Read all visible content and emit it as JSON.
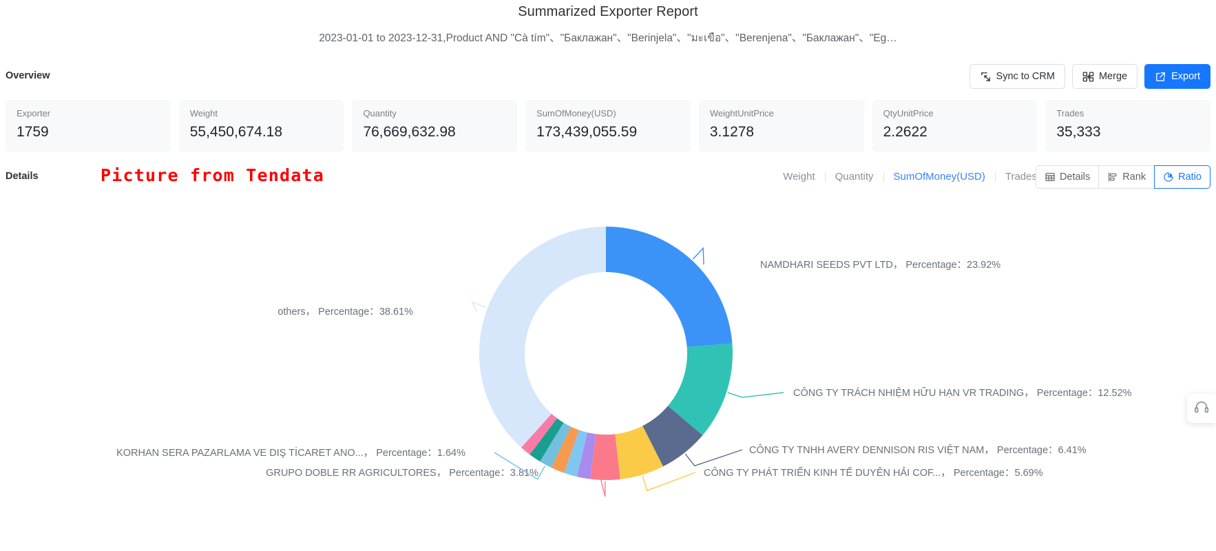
{
  "header": {
    "title": "Summarized Exporter Report",
    "subtitle": "2023-01-01 to 2023-12-31,Product AND \"Cà tím\"、\"Баклажан\"、\"Berinjela\"、\"มะเขือ\"、\"Berenjena\"、\"Баклажан\"、\"Eg…"
  },
  "overview": {
    "label": "Overview",
    "buttons": {
      "sync": "Sync to CRM",
      "merge": "Merge",
      "export": "Export"
    },
    "cards": [
      {
        "key": "Exporter",
        "value": "1759"
      },
      {
        "key": "Weight",
        "value": "55,450,674.18"
      },
      {
        "key": "Quantity",
        "value": "76,669,632.98"
      },
      {
        "key": "SumOfMoney(USD)",
        "value": "173,439,055.59"
      },
      {
        "key": "WeightUnitPrice",
        "value": "3.1278"
      },
      {
        "key": "QtyUnitPrice",
        "value": "2.2622"
      },
      {
        "key": "Trades",
        "value": "35,333"
      }
    ]
  },
  "details": {
    "label": "Details",
    "watermark": "Picture from Tendata",
    "metric_tabs": [
      {
        "label": "Weight",
        "active": false
      },
      {
        "label": "Quantity",
        "active": false
      },
      {
        "label": "SumOfMoney(USD)",
        "active": true
      },
      {
        "label": "Trades",
        "active": false
      }
    ],
    "view_toggle": [
      {
        "label": "Details",
        "icon": "table-icon",
        "active": false
      },
      {
        "label": "Rank",
        "icon": "bar-rank-icon",
        "active": false
      },
      {
        "label": "Ratio",
        "icon": "pie-chart-icon",
        "active": true
      }
    ]
  },
  "chart_data": {
    "type": "pie",
    "title": "",
    "variant": "donut",
    "metric": "SumOfMoney(USD)",
    "legend_position": "callout-labels",
    "percent_label_prefix": "Percentage：",
    "labels": [
      "NAMDHARI SEEDS PVT LTD",
      "CÔNG TY TRÁCH NHIỆM HỮU HẠN VR TRADING",
      "CÔNG TY TNHH AVERY DENNISON RIS VIỆT NAM",
      "CÔNG TY PHÁT TRIỂN KINH TẾ DUYÊN HẢI COF...",
      "GRUPO DOBLE RR AGRICULTORES",
      "KORHAN SERA PAZARLAMA VE DIŞ TİCARET ANO...",
      "others"
    ],
    "values": [
      23.92,
      12.52,
      6.41,
      5.69,
      3.81,
      1.64,
      38.61
    ],
    "percent_strings": [
      "23.92%",
      "12.52%",
      "6.41%",
      "5.69%",
      "3.81%",
      "1.64%",
      "38.61%"
    ],
    "colors": [
      "#3b93f7",
      "#30c3b5",
      "#5b6b8f",
      "#fbcb47",
      "#fa7a8b",
      "#73c0de",
      "#d6e6fb"
    ],
    "minor_slices": [
      {
        "label": "slice-7",
        "value": 1.7,
        "color": "#a98bf0"
      },
      {
        "label": "slice-8",
        "value": 1.7,
        "color": "#7fc7f0"
      },
      {
        "label": "slice-9",
        "value": 1.75,
        "color": "#f79a50"
      },
      {
        "label": "slice-10",
        "value": 1.55,
        "color": "#1a9e8f"
      },
      {
        "label": "slice-11",
        "value": 1.4,
        "color": "#f97ba8"
      }
    ]
  },
  "callouts": [
    {
      "text": "NAMDHARI SEEDS PVT LTD，  Percentage：23.92%",
      "color": "#3b93f7"
    },
    {
      "text": "CÔNG TY TRÁCH NHIỆM HỮU HẠN VR TRADING，  Percentage：12.52%",
      "color": "#30c3b5"
    },
    {
      "text": "CÔNG TY TNHH AVERY DENNISON RIS VIỆT NAM，  Percentage：6.41%",
      "color": "#5b6b8f"
    },
    {
      "text": "CÔNG TY PHÁT TRIỂN KINH TẾ DUYÊN HẢI COF...，  Percentage：5.69%",
      "color": "#fbcb47"
    },
    {
      "text": "GRUPO DOBLE RR AGRICULTORES，  Percentage：3.81%",
      "color": "#fa7a8b"
    },
    {
      "text": "KORHAN SERA PAZARLAMA VE DIŞ TİCARET ANO...，  Percentage：1.64%",
      "color": "#1a9e8f"
    },
    {
      "text": "others，  Percentage：38.61%",
      "color": "#d6e6fb"
    }
  ],
  "colors": {
    "accent": "#1677ff",
    "tab_active": "#3b82f6",
    "text_primary": "#303133",
    "text_secondary": "#606266",
    "text_muted": "#8a8f99",
    "card_bg": "#f8f9fb",
    "border": "#dcdfe6",
    "watermark": "#ff0000"
  }
}
